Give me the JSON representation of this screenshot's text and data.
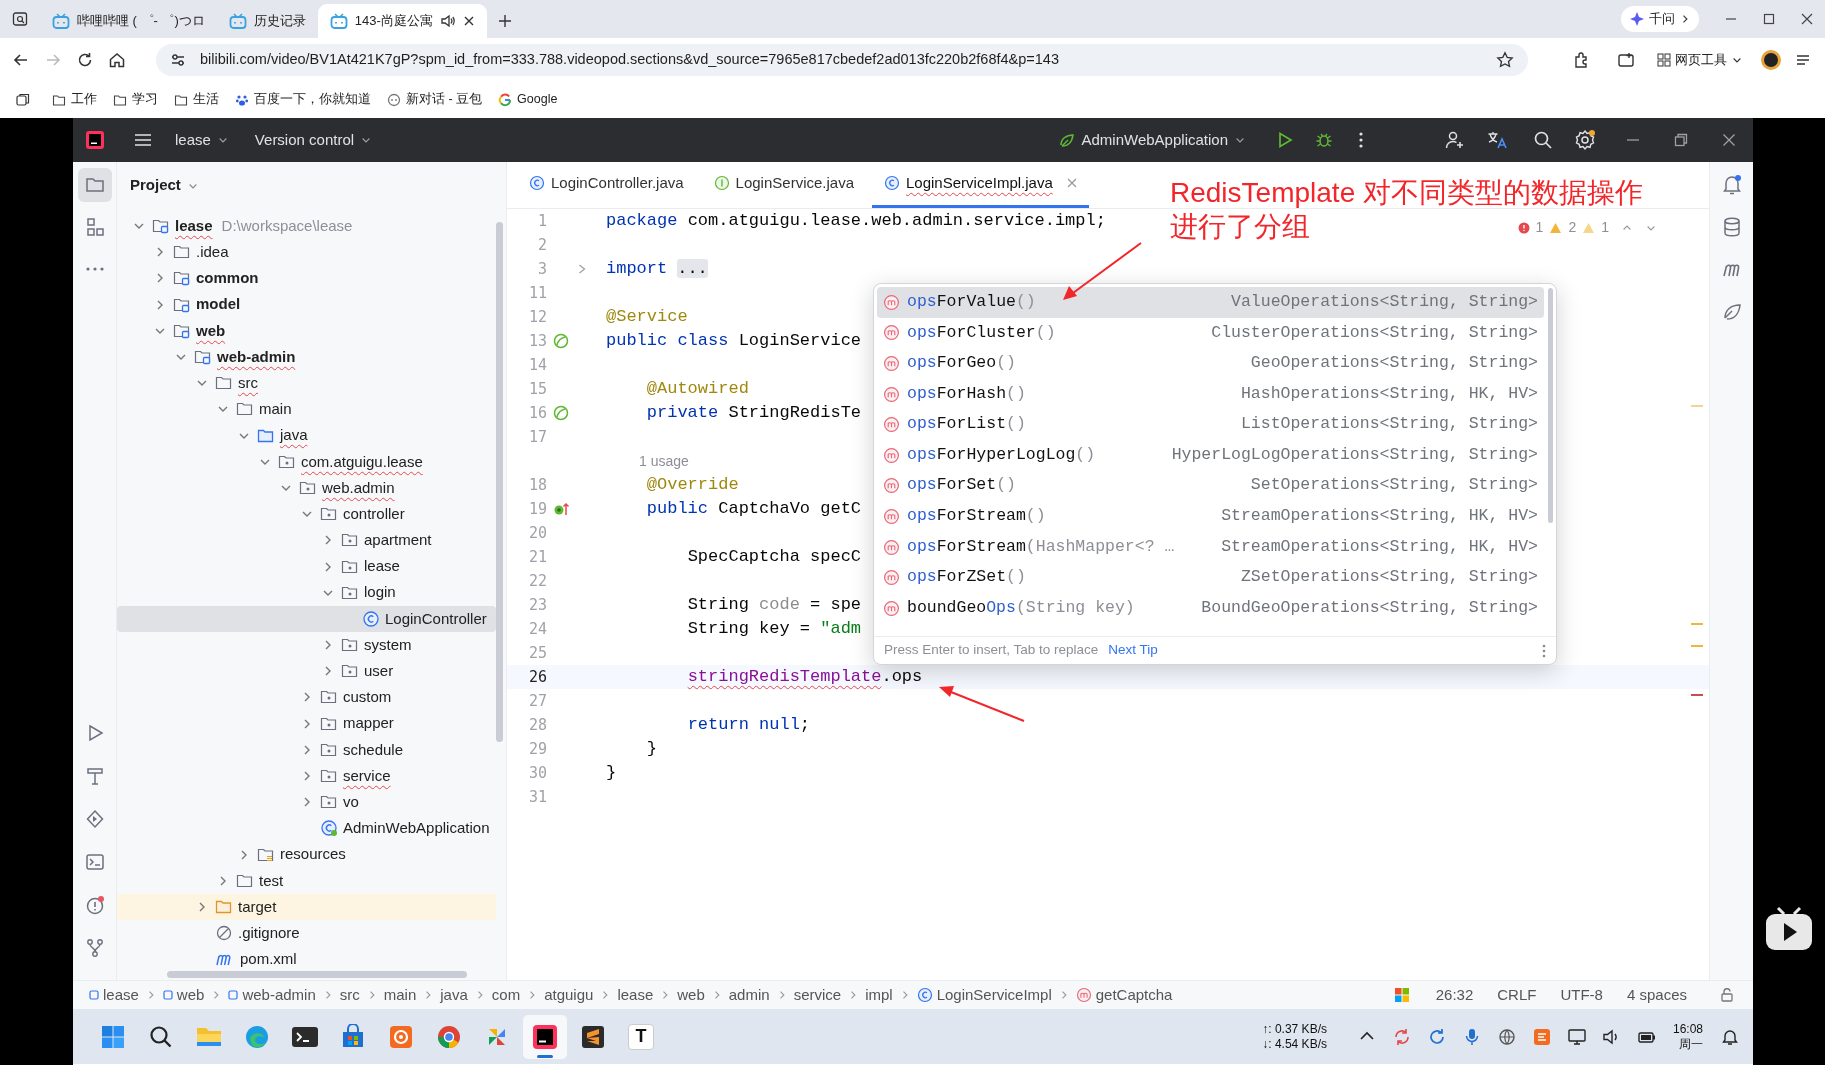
{
  "browser": {
    "tabs": [
      {
        "title": "哔哩哔哩 ( ゜- ゜)つロ",
        "selected": false,
        "audio": false
      },
      {
        "title": "历史记录",
        "selected": false,
        "audio": false
      },
      {
        "title": "143-尚庭公寓",
        "selected": true,
        "audio": true
      }
    ],
    "assistant": "千问",
    "url": "bilibili.com/video/BV1At421K7gP?spm_id_from=333.788.videopod.sections&vd_source=7965e817cbedef2ad013fc220b2f68f4&p=143",
    "tools_label": "网页工具",
    "bookmarks": [
      {
        "label": "工作",
        "kind": "folder"
      },
      {
        "label": "学习",
        "kind": "folder"
      },
      {
        "label": "生活",
        "kind": "folder"
      },
      {
        "label": "百度一下，你就知道",
        "kind": "baidu"
      },
      {
        "label": "新对话 - 豆包",
        "kind": "doubao"
      },
      {
        "label": "Google",
        "kind": "google"
      }
    ]
  },
  "ide": {
    "project_menu": "lease",
    "vcs_menu": "Version control",
    "run_config": "AdminWebApplication",
    "project_panel": {
      "title": "Project",
      "tree": [
        {
          "name": "lease",
          "kind": "module",
          "path": "D:\\workspace\\lease",
          "expanded": true,
          "selected": false,
          "excluded": false,
          "typo": true,
          "children": [
            {
              "name": ".idea",
              "kind": "folder",
              "expanded": false,
              "selected": false,
              "excluded": false,
              "typo": false
            },
            {
              "name": "common",
              "kind": "module",
              "expanded": false,
              "selected": false,
              "excluded": false,
              "typo": false
            },
            {
              "name": "model",
              "kind": "module",
              "expanded": false,
              "selected": false,
              "excluded": false,
              "typo": false
            },
            {
              "name": "web",
              "kind": "module",
              "expanded": true,
              "selected": false,
              "excluded": false,
              "typo": true,
              "children": [
                {
                  "name": "web-admin",
                  "kind": "module",
                  "expanded": true,
                  "selected": false,
                  "excluded": false,
                  "typo": true,
                  "children": [
                    {
                      "name": "src",
                      "kind": "folder",
                      "expanded": true,
                      "selected": false,
                      "excluded": false,
                      "typo": true,
                      "children": [
                        {
                          "name": "main",
                          "kind": "folder",
                          "expanded": true,
                          "selected": false,
                          "excluded": false,
                          "typo": false,
                          "children": [
                            {
                              "name": "java",
                              "kind": "source-root",
                              "expanded": true,
                              "selected": false,
                              "excluded": false,
                              "typo": true,
                              "children": [
                                {
                                  "name": "com.atguigu.lease",
                                  "kind": "package",
                                  "expanded": true,
                                  "selected": false,
                                  "excluded": false,
                                  "typo": true,
                                  "children": [
                                    {
                                      "name": "web.admin",
                                      "kind": "package",
                                      "expanded": true,
                                      "selected": false,
                                      "excluded": false,
                                      "typo": true,
                                      "children": [
                                        {
                                          "name": "controller",
                                          "kind": "package",
                                          "expanded": true,
                                          "selected": false,
                                          "excluded": false,
                                          "typo": false,
                                          "children": [
                                            {
                                              "name": "apartment",
                                              "kind": "package",
                                              "expanded": false,
                                              "selected": false,
                                              "excluded": false,
                                              "typo": false
                                            },
                                            {
                                              "name": "lease",
                                              "kind": "package",
                                              "expanded": false,
                                              "selected": false,
                                              "excluded": false,
                                              "typo": false
                                            },
                                            {
                                              "name": "login",
                                              "kind": "package",
                                              "expanded": true,
                                              "selected": false,
                                              "excluded": false,
                                              "typo": false,
                                              "children": [
                                                {
                                                  "name": "LoginController",
                                                  "kind": "class",
                                                  "selected": true,
                                                  "excluded": false,
                                                  "typo": false
                                                }
                                              ]
                                            },
                                            {
                                              "name": "system",
                                              "kind": "package",
                                              "expanded": false,
                                              "selected": false,
                                              "excluded": false,
                                              "typo": false
                                            },
                                            {
                                              "name": "user",
                                              "kind": "package",
                                              "expanded": false,
                                              "selected": false,
                                              "excluded": false,
                                              "typo": false
                                            }
                                          ]
                                        },
                                        {
                                          "name": "custom",
                                          "kind": "package",
                                          "expanded": false,
                                          "selected": false,
                                          "excluded": false,
                                          "typo": false
                                        },
                                        {
                                          "name": "mapper",
                                          "kind": "package",
                                          "expanded": false,
                                          "selected": false,
                                          "excluded": false,
                                          "typo": false
                                        },
                                        {
                                          "name": "schedule",
                                          "kind": "package",
                                          "expanded": false,
                                          "selected": false,
                                          "excluded": false,
                                          "typo": false
                                        },
                                        {
                                          "name": "service",
                                          "kind": "package",
                                          "expanded": false,
                                          "selected": false,
                                          "excluded": false,
                                          "typo": true
                                        },
                                        {
                                          "name": "vo",
                                          "kind": "package",
                                          "expanded": false,
                                          "selected": false,
                                          "excluded": false,
                                          "typo": false
                                        },
                                        {
                                          "name": "AdminWebApplication",
                                          "kind": "spring-class",
                                          "selected": false,
                                          "excluded": false,
                                          "typo": false
                                        }
                                      ]
                                    }
                                  ]
                                }
                              ]
                            },
                            {
                              "name": "resources",
                              "kind": "resources",
                              "expanded": false,
                              "selected": false,
                              "excluded": false,
                              "typo": false
                            }
                          ]
                        },
                        {
                          "name": "test",
                          "kind": "folder",
                          "expanded": false,
                          "selected": false,
                          "excluded": false,
                          "typo": false
                        }
                      ]
                    },
                    {
                      "name": "target",
                      "kind": "excluded-folder",
                      "expanded": false,
                      "selected": false,
                      "excluded": true,
                      "typo": false
                    },
                    {
                      "name": ".gitignore",
                      "kind": "gitignore",
                      "selected": false,
                      "excluded": false,
                      "typo": false
                    },
                    {
                      "name": "pom.xml",
                      "kind": "maven",
                      "selected": false,
                      "excluded": false,
                      "typo": false
                    }
                  ]
                }
              ]
            }
          ]
        }
      ]
    },
    "editor": {
      "tabs": [
        {
          "label": "LoginController.java",
          "kind": "class",
          "selected": false,
          "has_errors": false
        },
        {
          "label": "LoginService.java",
          "kind": "interface",
          "selected": false,
          "has_errors": false
        },
        {
          "label": "LoginServiceImpl.java",
          "kind": "class",
          "selected": true,
          "has_errors": true
        }
      ],
      "inspections": {
        "errors": "1",
        "warnings": "2",
        "weak_warnings": "1"
      },
      "lines": [
        {
          "kind": "code",
          "number": "1",
          "current": false,
          "folded": false,
          "bean_marker": false,
          "override_marker": false,
          "segments": [
            {
              "kind": "keyword",
              "text": "package"
            },
            {
              "kind": "plain",
              "text": " com.atguigu.lease.web.admin.service.impl;"
            }
          ]
        },
        {
          "kind": "code",
          "number": "2",
          "current": false,
          "folded": false,
          "bean_marker": false,
          "override_marker": false
        },
        {
          "kind": "code",
          "number": "3",
          "current": false,
          "folded": true,
          "bean_marker": false,
          "override_marker": false,
          "segments": [
            {
              "kind": "keyword",
              "text": "import"
            },
            {
              "kind": "folded",
              "text": "..."
            }
          ]
        },
        {
          "kind": "code",
          "number": "11",
          "current": false,
          "folded": false,
          "bean_marker": false,
          "override_marker": false
        },
        {
          "kind": "code",
          "number": "12",
          "current": false,
          "folded": false,
          "bean_marker": false,
          "override_marker": false,
          "segments": [
            {
              "kind": "annotation",
              "text": "@Service"
            }
          ]
        },
        {
          "kind": "code",
          "number": "13",
          "current": false,
          "folded": false,
          "bean_marker": true,
          "override_marker": false,
          "segments": [
            {
              "kind": "keyword",
              "text": "public class"
            },
            {
              "kind": "plain",
              "text": " LoginService"
            }
          ]
        },
        {
          "kind": "code",
          "number": "14",
          "current": false,
          "folded": false,
          "bean_marker": false,
          "override_marker": false
        },
        {
          "kind": "code",
          "number": "15",
          "current": false,
          "folded": false,
          "bean_marker": false,
          "override_marker": false,
          "segments": [
            {
              "kind": "annotation",
              "text": "    @Autowired"
            }
          ]
        },
        {
          "kind": "code",
          "number": "16",
          "current": false,
          "folded": false,
          "bean_marker": true,
          "override_marker": false,
          "segments": [
            {
              "kind": "keyword",
              "text": "    private"
            },
            {
              "kind": "plain",
              "text": " StringRedisTe"
            }
          ]
        },
        {
          "kind": "code",
          "number": "17",
          "current": false,
          "folded": false,
          "bean_marker": false,
          "override_marker": false
        },
        {
          "kind": "inlay",
          "text": "1 usage"
        },
        {
          "kind": "code",
          "number": "18",
          "current": false,
          "folded": false,
          "bean_marker": false,
          "override_marker": false,
          "segments": [
            {
              "kind": "annotation",
              "text": "    @Override"
            }
          ]
        },
        {
          "kind": "code",
          "number": "19",
          "current": false,
          "folded": false,
          "bean_marker": false,
          "override_marker": true,
          "segments": [
            {
              "kind": "keyword",
              "text": "    public"
            },
            {
              "kind": "plain",
              "text": " CaptchaVo getC"
            }
          ]
        },
        {
          "kind": "code",
          "number": "20",
          "current": false,
          "folded": false,
          "bean_marker": false,
          "override_marker": false
        },
        {
          "kind": "code",
          "number": "21",
          "current": false,
          "folded": false,
          "bean_marker": false,
          "override_marker": false,
          "segments": [
            {
              "kind": "plain",
              "text": "        SpecCaptcha specC"
            }
          ]
        },
        {
          "kind": "code",
          "number": "22",
          "current": false,
          "folded": false,
          "bean_marker": false,
          "override_marker": false
        },
        {
          "kind": "code",
          "number": "23",
          "current": false,
          "folded": false,
          "bean_marker": false,
          "override_marker": false,
          "segments": [
            {
              "kind": "plain",
              "text": "        String "
            },
            {
              "kind": "unused",
              "text": "code"
            },
            {
              "kind": "plain",
              "text": " = spe"
            }
          ]
        },
        {
          "kind": "code",
          "number": "24",
          "current": false,
          "folded": false,
          "bean_marker": false,
          "override_marker": false,
          "segments": [
            {
              "kind": "plain",
              "text": "        String key = "
            },
            {
              "kind": "string",
              "text": "\"adm"
            }
          ]
        },
        {
          "kind": "code",
          "number": "25",
          "current": false,
          "folded": false,
          "bean_marker": false,
          "override_marker": false
        },
        {
          "kind": "code",
          "number": "26",
          "current": true,
          "folded": false,
          "bean_marker": false,
          "override_marker": false,
          "segments": [
            {
              "kind": "misspelled_field",
              "text": "        stringRedisTemplate"
            },
            {
              "kind": "plain",
              "text": ".ops"
            }
          ]
        },
        {
          "kind": "code",
          "number": "27",
          "current": false,
          "folded": false,
          "bean_marker": false,
          "override_marker": false
        },
        {
          "kind": "code",
          "number": "28",
          "current": false,
          "folded": false,
          "bean_marker": false,
          "override_marker": false,
          "segments": [
            {
              "kind": "keyword",
              "text": "        return null"
            },
            {
              "kind": "plain",
              "text": ";"
            }
          ]
        },
        {
          "kind": "code",
          "number": "29",
          "current": false,
          "folded": false,
          "bean_marker": false,
          "override_marker": false,
          "segments": [
            {
              "kind": "plain",
              "text": "    }"
            }
          ]
        },
        {
          "kind": "code",
          "number": "30",
          "current": false,
          "folded": false,
          "bean_marker": false,
          "override_marker": false,
          "segments": [
            {
              "kind": "plain",
              "text": "}"
            }
          ]
        },
        {
          "kind": "code",
          "number": "31",
          "current": false,
          "folded": false,
          "bean_marker": false,
          "override_marker": false
        }
      ]
    },
    "completion": {
      "items": [
        {
          "selected": true,
          "match": "ops",
          "tail": "ForValue",
          "params": "()",
          "type": "ValueOperations<String, String>"
        },
        {
          "selected": false,
          "match": "ops",
          "tail": "ForCluster",
          "params": "()",
          "type": "ClusterOperations<String, String>"
        },
        {
          "selected": false,
          "match": "ops",
          "tail": "ForGeo",
          "params": "()",
          "type": "GeoOperations<String, String>"
        },
        {
          "selected": false,
          "match": "ops",
          "tail": "ForHash",
          "params": "()",
          "type": "HashOperations<String, HK, HV>"
        },
        {
          "selected": false,
          "match": "ops",
          "tail": "ForList",
          "params": "()",
          "type": "ListOperations<String, String>"
        },
        {
          "selected": false,
          "match": "ops",
          "tail": "ForHyperLogLog",
          "params": "()",
          "type": "HyperLogLogOperations<String, String>"
        },
        {
          "selected": false,
          "match": "ops",
          "tail": "ForSet",
          "params": "()",
          "type": "SetOperations<String, String>"
        },
        {
          "selected": false,
          "match": "ops",
          "tail": "ForStream",
          "params": "()",
          "type": "StreamOperations<String, HK, HV>"
        },
        {
          "selected": false,
          "match": "ops",
          "tail": "ForStream",
          "params": "(HashMapper<? …",
          "type": "StreamOperations<String, HK, HV>"
        },
        {
          "selected": false,
          "match": "ops",
          "tail": "ForZSet",
          "params": "()",
          "type": "ZSetOperations<String, String>"
        },
        {
          "selected": false,
          "lead": "boundGeo",
          "match": "Ops",
          "params": "(String key)",
          "type": "BoundGeoOperations<String, String>"
        }
      ],
      "hint": "Press Enter to insert, Tab to replace",
      "next_tip": "Next Tip"
    },
    "annotation": {
      "lines": [
        "RedisTemplate 对不同类型的数据操作",
        "进行了分组"
      ]
    },
    "breadcrumbs": [
      {
        "text": "lease",
        "kind": "module"
      },
      {
        "text": "web",
        "kind": "module"
      },
      {
        "text": "web-admin",
        "kind": "module"
      },
      {
        "text": "src",
        "kind": "plain"
      },
      {
        "text": "main",
        "kind": "plain"
      },
      {
        "text": "java",
        "kind": "plain"
      },
      {
        "text": "com",
        "kind": "plain"
      },
      {
        "text": "atguigu",
        "kind": "plain"
      },
      {
        "text": "lease",
        "kind": "plain"
      },
      {
        "text": "web",
        "kind": "plain"
      },
      {
        "text": "admin",
        "kind": "plain"
      },
      {
        "text": "service",
        "kind": "plain"
      },
      {
        "text": "impl",
        "kind": "plain"
      },
      {
        "text": "LoginServiceImpl",
        "kind": "class"
      },
      {
        "text": "getCaptcha",
        "kind": "method"
      }
    ],
    "status": {
      "position": "26:32",
      "line_separator": "CRLF",
      "encoding": "UTF-8",
      "indent": "4 spaces"
    }
  },
  "taskbar": {
    "apps": [
      {
        "kind": "start",
        "active": false
      },
      {
        "kind": "search",
        "active": false
      },
      {
        "kind": "explorer",
        "active": false
      },
      {
        "kind": "edge",
        "active": false
      },
      {
        "kind": "terminal",
        "active": false
      },
      {
        "kind": "store",
        "active": false
      },
      {
        "kind": "orange",
        "active": false
      },
      {
        "kind": "chrome",
        "active": false
      },
      {
        "kind": "pinwheel",
        "active": false
      },
      {
        "kind": "intellij",
        "active": true
      },
      {
        "kind": "sublime",
        "active": false
      },
      {
        "kind": "text",
        "glyph": "T",
        "active": false
      }
    ],
    "upload": "↑: 0.37 KB/s",
    "download": "↓: 4.54 KB/s",
    "time": "16:08",
    "date": "周一"
  }
}
